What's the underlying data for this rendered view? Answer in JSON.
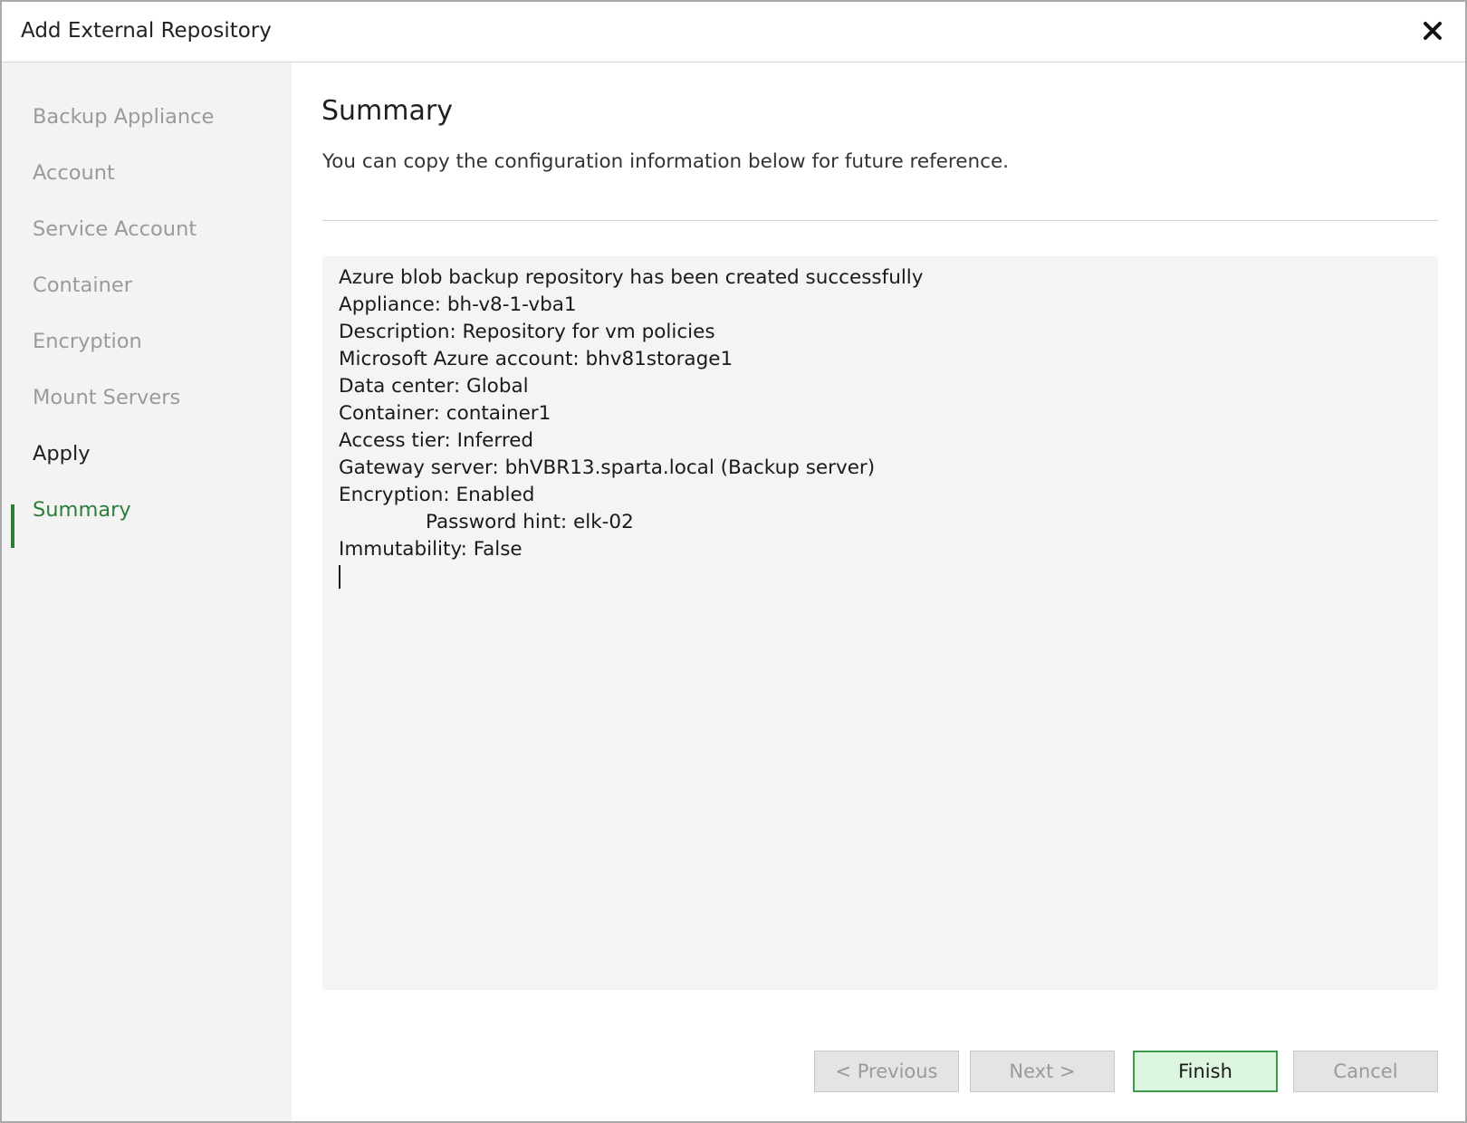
{
  "window": {
    "title": "Add External Repository"
  },
  "sidebar": {
    "items": [
      {
        "label": "Backup Appliance",
        "state": "pending"
      },
      {
        "label": "Account",
        "state": "pending"
      },
      {
        "label": "Service Account",
        "state": "pending"
      },
      {
        "label": "Container",
        "state": "pending"
      },
      {
        "label": "Encryption",
        "state": "pending"
      },
      {
        "label": "Mount Servers",
        "state": "pending"
      },
      {
        "label": "Apply",
        "state": "done"
      },
      {
        "label": "Summary",
        "state": "active"
      }
    ]
  },
  "main": {
    "heading": "Summary",
    "subtitle": "You can copy the configuration information below for future reference.",
    "summary_lines": [
      "Azure blob backup repository has been created successfully",
      "Appliance: bh-v8-1-vba1",
      "Description: Repository for vm policies",
      "Microsoft Azure account: bhv81storage1",
      "Data center: Global",
      "Container: container1",
      "Access tier: Inferred",
      "Gateway server: bhVBR13.sparta.local (Backup server)",
      "Encryption: Enabled",
      "Password hint: elk-02",
      "Immutability: False"
    ]
  },
  "buttons": {
    "previous": "< Previous",
    "next": "Next >",
    "finish": "Finish",
    "cancel": "Cancel"
  },
  "colors": {
    "accent": "#2d7d3a",
    "finish_bg": "#dcf5df",
    "finish_border": "#3c9a4c",
    "sidebar_bg": "#f3f3f3",
    "summary_bg": "#f3f4f4"
  },
  "icons": {
    "close": "close-icon"
  }
}
